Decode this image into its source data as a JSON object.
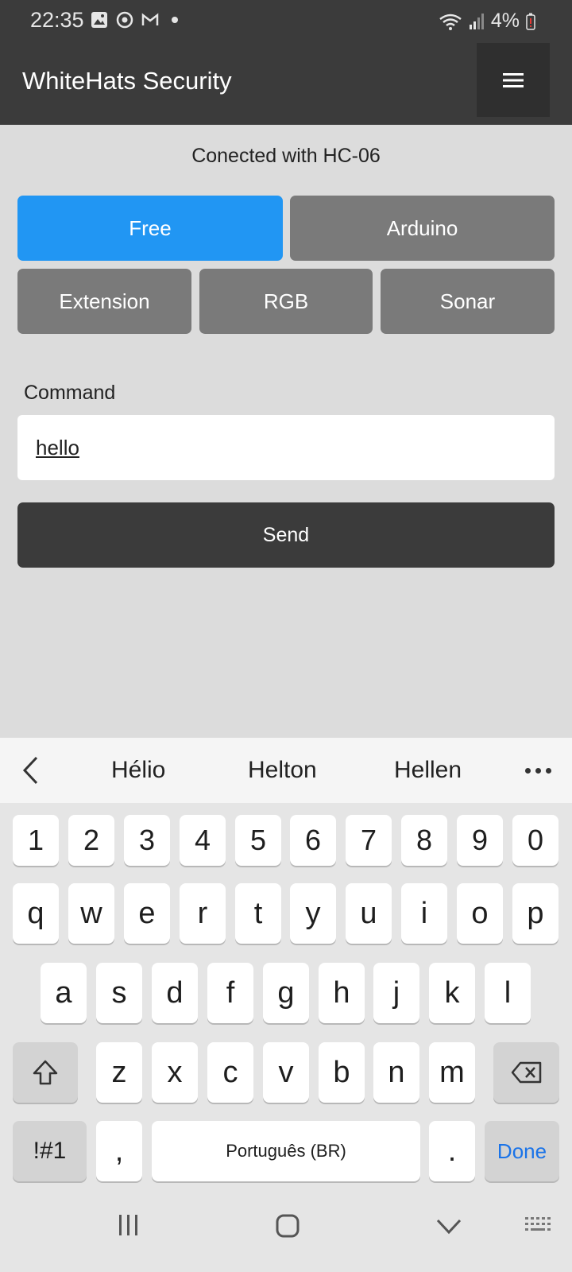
{
  "status": {
    "time": "22:35",
    "battery": "4%"
  },
  "app": {
    "title": "WhiteHats Security"
  },
  "connection": {
    "text": "Conected with HC-06"
  },
  "modes": {
    "free": "Free",
    "arduino": "Arduino",
    "extension": "Extension",
    "rgb": "RGB",
    "sonar": "Sonar",
    "active": "Free",
    "active_color": "#2196f3",
    "inactive_color": "#7a7a7a"
  },
  "command": {
    "label": "Command",
    "value": "hello"
  },
  "send": {
    "label": "Send"
  },
  "suggestions": [
    "Hélio",
    "Helton",
    "Hellen"
  ],
  "keyboard": {
    "row_numbers": [
      "1",
      "2",
      "3",
      "4",
      "5",
      "6",
      "7",
      "8",
      "9",
      "0"
    ],
    "row1": [
      "q",
      "w",
      "e",
      "r",
      "t",
      "y",
      "u",
      "i",
      "o",
      "p"
    ],
    "row2": [
      "a",
      "s",
      "d",
      "f",
      "g",
      "h",
      "j",
      "k",
      "l"
    ],
    "row3": [
      "z",
      "x",
      "c",
      "v",
      "b",
      "n",
      "m"
    ],
    "sym": "!#1",
    "comma": ",",
    "space": "Português (BR)",
    "period": ".",
    "done": "Done"
  }
}
